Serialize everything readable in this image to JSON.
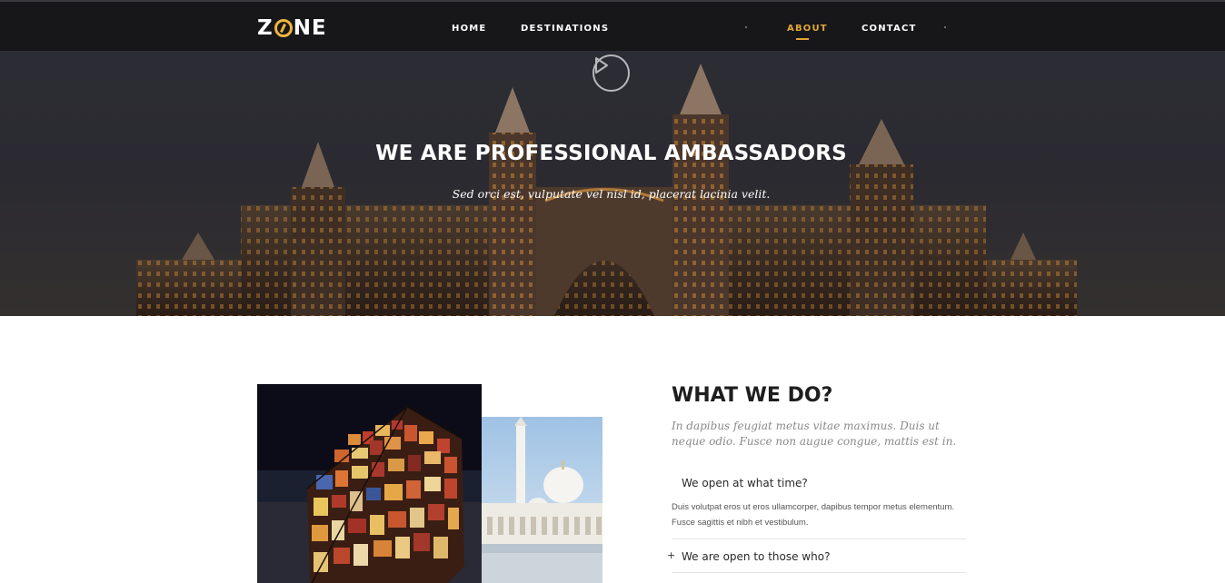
{
  "brand": {
    "logo_left": "Z",
    "logo_right": "NE",
    "accent": "#e2a637"
  },
  "nav": {
    "items": [
      {
        "label": "HOME"
      },
      {
        "label": "DESTINATIONS"
      },
      {
        "label": "ABOUT",
        "active": true
      },
      {
        "label": "CONTACT"
      }
    ]
  },
  "hero": {
    "play_icon": "play-circle-icon",
    "title": "WE ARE PROFESSIONAL AMBASSADORS",
    "subtitle": "Sed orci est, vulputate vel nisl id, placerat lacinia velit."
  },
  "about": {
    "title": "WHAT WE DO?",
    "intro": "In dapibus feugiat metus vitae maximus. Duis ut neque odio. Fusce non augue congue, mattis est in.",
    "faq": [
      {
        "question": "We open at what time?",
        "expanded": true,
        "answer": "Duis volutpat eros ut eros ullamcorper, dapibus tempor metus elementum. Fusce sagittis et nibh et vestibulum."
      },
      {
        "question": "We are open to those who?",
        "expanded": false,
        "toggle_icon": "+"
      }
    ]
  }
}
